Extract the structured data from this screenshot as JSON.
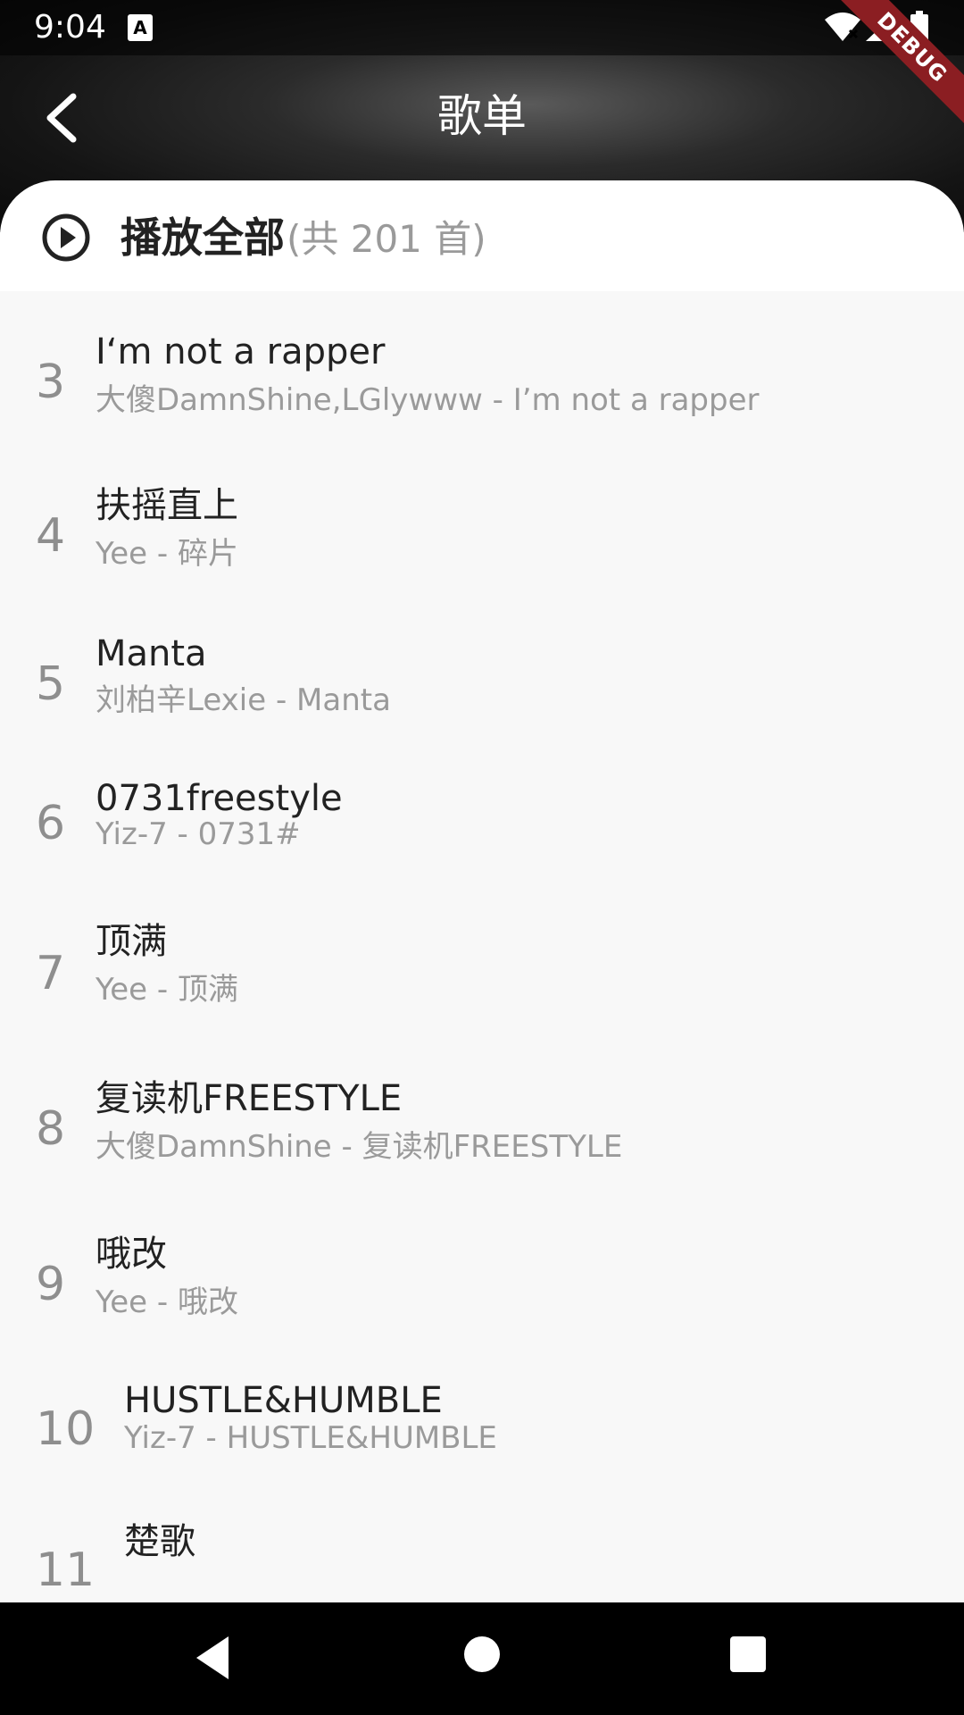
{
  "status": {
    "time": "9:04",
    "a_badge": "A"
  },
  "debug_label": "DEBUG",
  "header": {
    "title": "歌单"
  },
  "play_all": {
    "label": "播放全部",
    "count": "(共 201 首)"
  },
  "songs": [
    {
      "index": "3",
      "title": "I‘m not a rapper",
      "subtitle": "大傻DamnShine,LGlywww - I’m not a rapper"
    },
    {
      "index": "4",
      "title": "扶摇直上",
      "subtitle": "Yee - 碎片"
    },
    {
      "index": "5",
      "title": "Manta",
      "subtitle": "刘柏辛Lexie - Manta"
    },
    {
      "index": "6",
      "title": "0731freestyle",
      "subtitle": "Yiz-7 - 0731#"
    },
    {
      "index": "7",
      "title": "顶满",
      "subtitle": "Yee - 顶满"
    },
    {
      "index": "8",
      "title": "复读机FREESTYLE",
      "subtitle": "大傻DamnShine - 复读机FREESTYLE"
    },
    {
      "index": "9",
      "title": "哦改",
      "subtitle": "Yee - 哦改"
    },
    {
      "index": "10",
      "title": "HUSTLE&HUMBLE",
      "subtitle": "Yiz-7 - HUSTLE&HUMBLE"
    },
    {
      "index": "11",
      "title": "楚歌",
      "subtitle": ""
    }
  ]
}
